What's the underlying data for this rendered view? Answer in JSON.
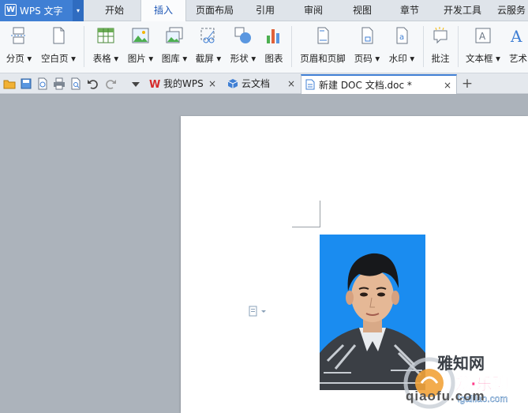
{
  "app": {
    "logo": "W",
    "name": "WPS 文字",
    "dropdown": "▾",
    "accent": "#3f7fd4"
  },
  "menu_tabs": [
    "开始",
    "插入",
    "页面布局",
    "引用",
    "审阅",
    "视图",
    "章节",
    "开发工具",
    "云服务"
  ],
  "active_menu_tab": "插入",
  "ribbon": {
    "page_break": "分页",
    "blank_page": "空白页",
    "table": "表格",
    "picture": "图片",
    "gallery": "图库",
    "screenshot": "截屏",
    "shapes": "形状",
    "chart": "图表",
    "header_footer": "页眉和页脚",
    "page_number": "页码",
    "watermark": "水印",
    "comment": "批注",
    "textbox": "文本框",
    "art_text": "艺术"
  },
  "tabs": [
    {
      "name": "我的WPS",
      "icon": "wps-logo-icon",
      "close": "×"
    },
    {
      "name": "云文档",
      "icon": "cloud-doc-icon",
      "close": "×"
    },
    {
      "name": "新建 DOC 文档.doc *",
      "icon": "doc-icon",
      "close": "×"
    }
  ],
  "new_tab": "+",
  "watermark_text": {
    "site": "qiaofu.com",
    "logo_text": "爱·乐聊",
    "sub": "igalilao.com",
    "brand": "雅知网"
  }
}
